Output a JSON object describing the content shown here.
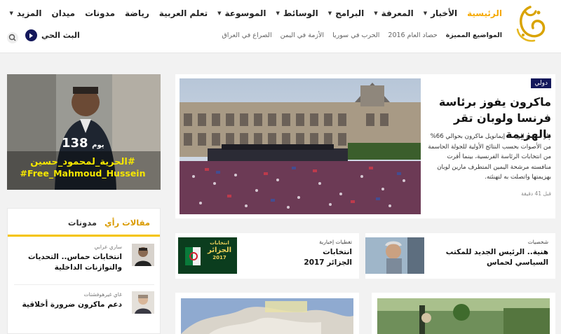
{
  "nav": {
    "items": [
      {
        "label": "الرئيسية",
        "active": true,
        "has_menu": false
      },
      {
        "label": "الأخبار",
        "active": false,
        "has_menu": true
      },
      {
        "label": "المعرفة",
        "active": false,
        "has_menu": true
      },
      {
        "label": "البرامج",
        "active": false,
        "has_menu": true
      },
      {
        "label": "الوسائط",
        "active": false,
        "has_menu": true
      },
      {
        "label": "الموسوعة",
        "active": false,
        "has_menu": true
      },
      {
        "label": "تعلم العربية",
        "active": false,
        "has_menu": false
      },
      {
        "label": "رياضة",
        "active": false,
        "has_menu": false
      },
      {
        "label": "مدونات",
        "active": false,
        "has_menu": false
      },
      {
        "label": "ميدان",
        "active": false,
        "has_menu": false
      },
      {
        "label": "المزيد",
        "active": false,
        "has_menu": true
      }
    ]
  },
  "topics": {
    "featured_label": "المواضيع المميزة",
    "items": [
      "حصاد العام 2016",
      "الحرب في سوريا",
      "الأزمة في اليمن",
      "الصراع في العراق"
    ]
  },
  "live": {
    "label": "البث الحي"
  },
  "colors": {
    "accent": "#f5a800",
    "navy": "#14185b",
    "promo_text": "#f5e600"
  },
  "main_story": {
    "badge": "دولي",
    "headline": "ماكرون يفوز برئاسة فرنسا ولوبان تقر بالهزيمة",
    "summary": "فاز مرشح الوسط إيمانويل ماكرون بحوالي 66% من الأصوات بحسب النتائج الأولية للجولة الحاسمة من انتخابات الرئاسة الفرنسية، بينما أقرت منافسته مرشحة اليمين المتطرف مارين لوبان بهزيمتها واتصلت به لتهنئته.",
    "time": "قبل 41 دقيقة"
  },
  "promo": {
    "days_number": "138",
    "days_unit": "يوم",
    "tag_arabic": "#الحرية_لمحمود_حسين",
    "tag_english": "#Free_Mahmoud_Hussein"
  },
  "opinion": {
    "tabs": [
      {
        "label": "مقالات رأي",
        "active": true
      },
      {
        "label": "مدونات",
        "active": false
      }
    ],
    "items": [
      {
        "author": "ساري عرابي",
        "title": "انتخابات حماس.. التحديات والتوازنات الداخلية"
      },
      {
        "author": "غاي غيرهوفشتات",
        "title": "دعم ماكرون ضرورة أخلاقية"
      }
    ]
  },
  "stories": [
    {
      "category": "شخصيات",
      "title": "هنية.. الرئيس الجديد للمكتب السياسي لحماس"
    },
    {
      "category": "تغطيات إخبارية",
      "title": "انتخابات الجزائر 2017",
      "thumb_text_1": "انتخابات",
      "thumb_text_2": "الجزائر",
      "thumb_text_3": "2017"
    }
  ]
}
